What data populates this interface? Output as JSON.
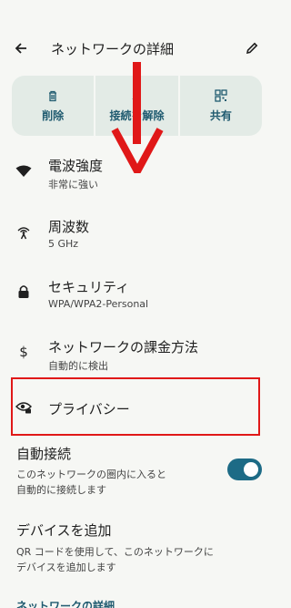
{
  "header": {
    "title": "ネットワークの詳細"
  },
  "actions": [
    {
      "label": "削除",
      "icon": "trash-icon"
    },
    {
      "label": "接続を解除",
      "icon": "disconnect-icon"
    },
    {
      "label": "共有",
      "icon": "qr-code-icon"
    }
  ],
  "details": {
    "signal": {
      "title": "電波強度",
      "value": "非常に強い",
      "icon": "wifi-signal-icon"
    },
    "frequency": {
      "title": "周波数",
      "value": "5 GHz",
      "icon": "antenna-icon"
    },
    "security": {
      "title": "セキュリティ",
      "value": "WPA/WPA2-Personal",
      "icon": "lock-icon"
    },
    "metered": {
      "title": "ネットワークの課金方法",
      "value": "自動的に検出",
      "icon": "dollar-icon"
    },
    "privacy": {
      "title": "プライバシー",
      "icon": "privacy-eye-icon"
    },
    "autoconnect": {
      "title": "自動接続",
      "description_line1": "このネットワークの圏内に入ると",
      "description_line2": "自動的に接続します",
      "enabled": true
    },
    "add_device": {
      "title": "デバイスを追加",
      "description_line1": "QR コードを使用して、このネットワークに",
      "description_line2": "デバイスを追加します"
    }
  },
  "footer_section": {
    "label": "ネットワークの詳細"
  },
  "colors": {
    "accent": "#1d6b86",
    "action_bg": "#e3ebe6",
    "annotation": "#e01818"
  }
}
